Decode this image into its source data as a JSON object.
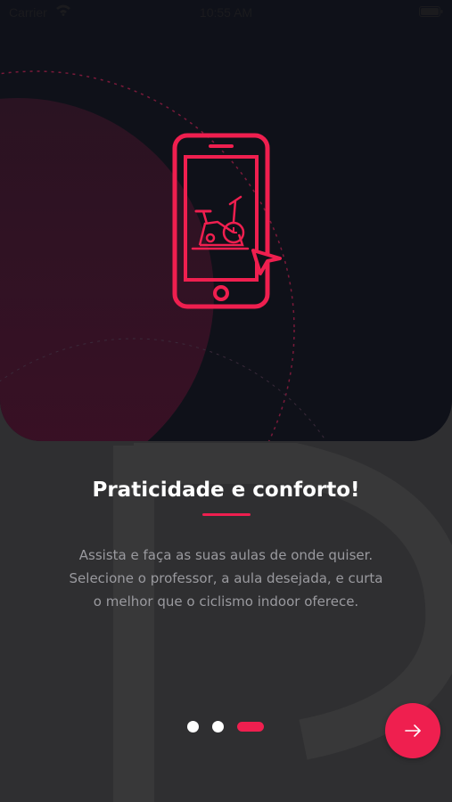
{
  "status_bar": {
    "carrier": "Carrier",
    "time": "10:55 AM",
    "wifi_icon": "wifi-icon",
    "battery_icon": "battery-icon"
  },
  "hero": {
    "illustration_icon": "phone-with-exercise-bike-icon"
  },
  "onboarding": {
    "title": "Praticidade e conforto!",
    "description": "Assista e faça as suas aulas de onde quiser.\nSelecione o professor, a aula desejada, e curta\no melhor que o ciclismo indoor oferece.",
    "pager": {
      "total": 3,
      "active_index": 2
    },
    "next_button_icon": "arrow-right-icon"
  },
  "colors": {
    "accent": "#ef1f4f",
    "hero_background": "#0f1119",
    "page_background": "#2f2f31",
    "text_primary": "#ffffff",
    "text_secondary": "#9a9a9f"
  }
}
